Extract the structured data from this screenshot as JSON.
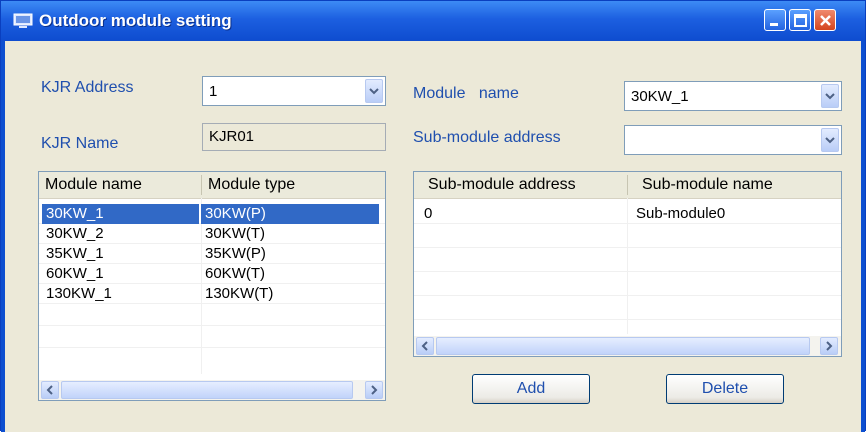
{
  "window": {
    "title": "Outdoor module setting"
  },
  "form": {
    "kjr_address": {
      "label": "KJR Address",
      "value": "1"
    },
    "kjr_name": {
      "label": "KJR Name",
      "value": "KJR01"
    },
    "module_name": {
      "label": "Module   name",
      "value": "30KW_1"
    },
    "sub_module_address": {
      "label": "Sub-module address",
      "value": ""
    }
  },
  "module_table": {
    "columns": [
      "Module name",
      "Module type"
    ],
    "rows": [
      [
        "30KW_1",
        "30KW(P)"
      ],
      [
        "30KW_2",
        "30KW(T)"
      ],
      [
        "35KW_1",
        "35KW(P)"
      ],
      [
        "60KW_1",
        "60KW(T)"
      ],
      [
        "130KW_1",
        "130KW(T)"
      ]
    ],
    "selected_row": 0
  },
  "submodule_table": {
    "columns": [
      "Sub-module address",
      "Sub-module name"
    ],
    "rows": [
      [
        "0",
        "Sub-module0"
      ]
    ]
  },
  "buttons": {
    "add": "Add",
    "delete": "Delete"
  },
  "icons": {
    "window": "window-icon",
    "minimize": "minimize-icon",
    "maximize": "maximize-icon",
    "close": "close-icon",
    "dropdown": "chevron-down-icon",
    "scroll_left": "arrow-left-icon",
    "scroll_right": "arrow-right-icon"
  },
  "colors": {
    "title_bar": "#1c5fe0",
    "selection": "#3169c6",
    "label_text": "#1f4fae",
    "close_button": "#d4441e"
  }
}
